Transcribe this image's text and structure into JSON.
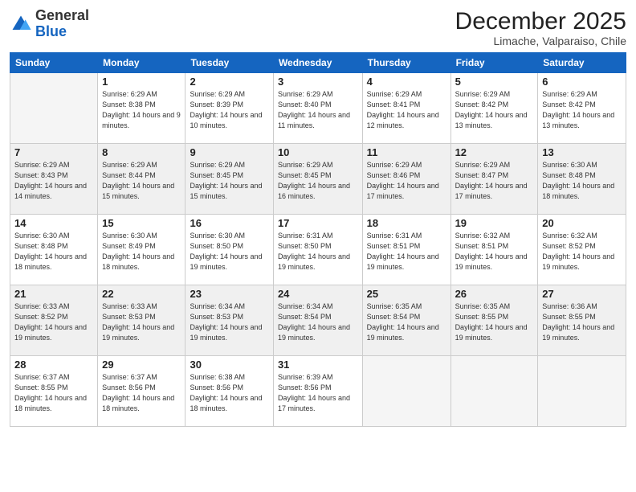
{
  "logo": {
    "general": "General",
    "blue": "Blue"
  },
  "header": {
    "month": "December 2025",
    "location": "Limache, Valparaiso, Chile"
  },
  "weekdays": [
    "Sunday",
    "Monday",
    "Tuesday",
    "Wednesday",
    "Thursday",
    "Friday",
    "Saturday"
  ],
  "weeks": [
    [
      {
        "day": "",
        "empty": true
      },
      {
        "day": "1",
        "sunrise": "6:29 AM",
        "sunset": "8:38 PM",
        "daylight": "14 hours and 9 minutes."
      },
      {
        "day": "2",
        "sunrise": "6:29 AM",
        "sunset": "8:39 PM",
        "daylight": "14 hours and 10 minutes."
      },
      {
        "day": "3",
        "sunrise": "6:29 AM",
        "sunset": "8:40 PM",
        "daylight": "14 hours and 11 minutes."
      },
      {
        "day": "4",
        "sunrise": "6:29 AM",
        "sunset": "8:41 PM",
        "daylight": "14 hours and 12 minutes."
      },
      {
        "day": "5",
        "sunrise": "6:29 AM",
        "sunset": "8:42 PM",
        "daylight": "14 hours and 13 minutes."
      },
      {
        "day": "6",
        "sunrise": "6:29 AM",
        "sunset": "8:42 PM",
        "daylight": "14 hours and 13 minutes."
      }
    ],
    [
      {
        "day": "7",
        "sunrise": "6:29 AM",
        "sunset": "8:43 PM",
        "daylight": "14 hours and 14 minutes."
      },
      {
        "day": "8",
        "sunrise": "6:29 AM",
        "sunset": "8:44 PM",
        "daylight": "14 hours and 15 minutes."
      },
      {
        "day": "9",
        "sunrise": "6:29 AM",
        "sunset": "8:45 PM",
        "daylight": "14 hours and 15 minutes."
      },
      {
        "day": "10",
        "sunrise": "6:29 AM",
        "sunset": "8:45 PM",
        "daylight": "14 hours and 16 minutes."
      },
      {
        "day": "11",
        "sunrise": "6:29 AM",
        "sunset": "8:46 PM",
        "daylight": "14 hours and 17 minutes."
      },
      {
        "day": "12",
        "sunrise": "6:29 AM",
        "sunset": "8:47 PM",
        "daylight": "14 hours and 17 minutes."
      },
      {
        "day": "13",
        "sunrise": "6:30 AM",
        "sunset": "8:48 PM",
        "daylight": "14 hours and 18 minutes."
      }
    ],
    [
      {
        "day": "14",
        "sunrise": "6:30 AM",
        "sunset": "8:48 PM",
        "daylight": "14 hours and 18 minutes."
      },
      {
        "day": "15",
        "sunrise": "6:30 AM",
        "sunset": "8:49 PM",
        "daylight": "14 hours and 18 minutes."
      },
      {
        "day": "16",
        "sunrise": "6:30 AM",
        "sunset": "8:50 PM",
        "daylight": "14 hours and 19 minutes."
      },
      {
        "day": "17",
        "sunrise": "6:31 AM",
        "sunset": "8:50 PM",
        "daylight": "14 hours and 19 minutes."
      },
      {
        "day": "18",
        "sunrise": "6:31 AM",
        "sunset": "8:51 PM",
        "daylight": "14 hours and 19 minutes."
      },
      {
        "day": "19",
        "sunrise": "6:32 AM",
        "sunset": "8:51 PM",
        "daylight": "14 hours and 19 minutes."
      },
      {
        "day": "20",
        "sunrise": "6:32 AM",
        "sunset": "8:52 PM",
        "daylight": "14 hours and 19 minutes."
      }
    ],
    [
      {
        "day": "21",
        "sunrise": "6:33 AM",
        "sunset": "8:52 PM",
        "daylight": "14 hours and 19 minutes."
      },
      {
        "day": "22",
        "sunrise": "6:33 AM",
        "sunset": "8:53 PM",
        "daylight": "14 hours and 19 minutes."
      },
      {
        "day": "23",
        "sunrise": "6:34 AM",
        "sunset": "8:53 PM",
        "daylight": "14 hours and 19 minutes."
      },
      {
        "day": "24",
        "sunrise": "6:34 AM",
        "sunset": "8:54 PM",
        "daylight": "14 hours and 19 minutes."
      },
      {
        "day": "25",
        "sunrise": "6:35 AM",
        "sunset": "8:54 PM",
        "daylight": "14 hours and 19 minutes."
      },
      {
        "day": "26",
        "sunrise": "6:35 AM",
        "sunset": "8:55 PM",
        "daylight": "14 hours and 19 minutes."
      },
      {
        "day": "27",
        "sunrise": "6:36 AM",
        "sunset": "8:55 PM",
        "daylight": "14 hours and 19 minutes."
      }
    ],
    [
      {
        "day": "28",
        "sunrise": "6:37 AM",
        "sunset": "8:55 PM",
        "daylight": "14 hours and 18 minutes."
      },
      {
        "day": "29",
        "sunrise": "6:37 AM",
        "sunset": "8:56 PM",
        "daylight": "14 hours and 18 minutes."
      },
      {
        "day": "30",
        "sunrise": "6:38 AM",
        "sunset": "8:56 PM",
        "daylight": "14 hours and 18 minutes."
      },
      {
        "day": "31",
        "sunrise": "6:39 AM",
        "sunset": "8:56 PM",
        "daylight": "14 hours and 17 minutes."
      },
      {
        "day": "",
        "empty": true
      },
      {
        "day": "",
        "empty": true
      },
      {
        "day": "",
        "empty": true
      }
    ]
  ]
}
